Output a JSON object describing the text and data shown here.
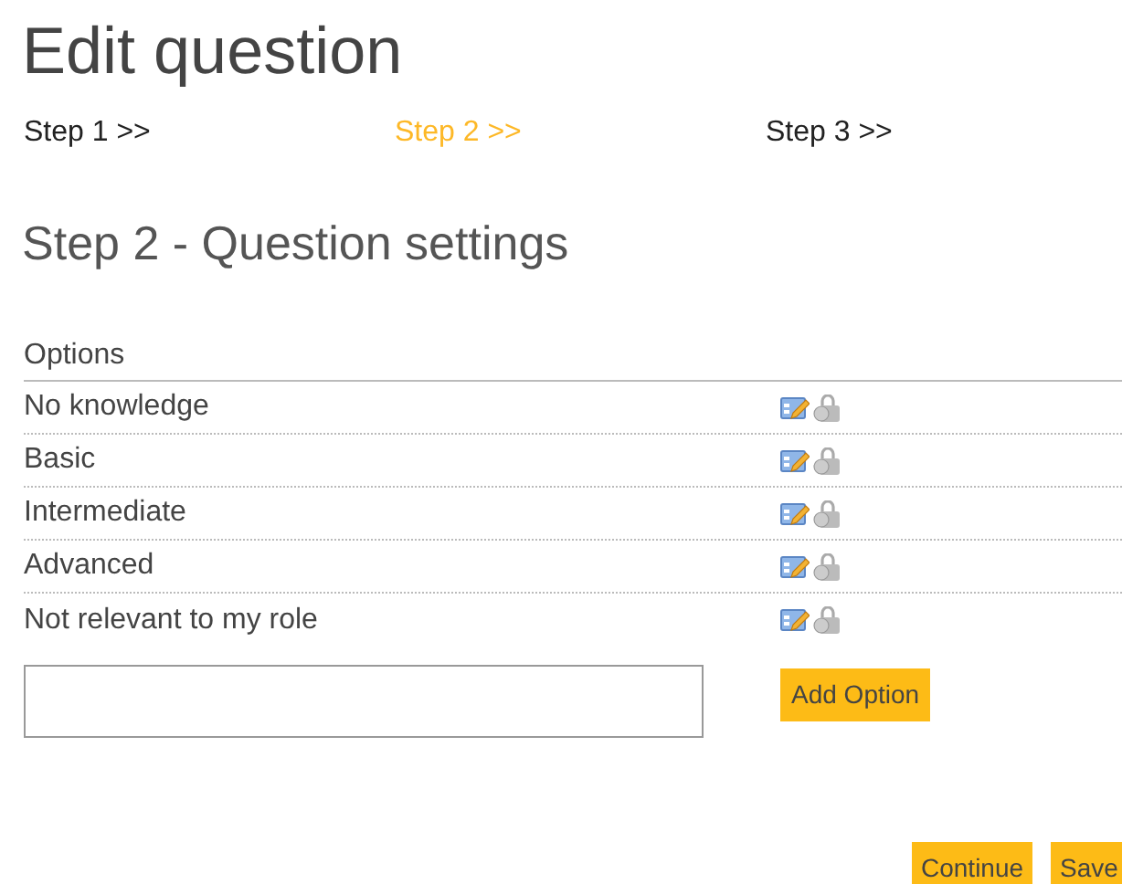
{
  "title": "Edit question",
  "steps": [
    {
      "label": "Step 1 >>",
      "selected": false
    },
    {
      "label": "Step 2 >>",
      "selected": true
    },
    {
      "label": "Step 3 >>",
      "selected": false
    }
  ],
  "section_title": "Step 2 - Question settings",
  "options_header": "Options",
  "options": [
    {
      "label": "No knowledge"
    },
    {
      "label": "Basic"
    },
    {
      "label": "Intermediate"
    },
    {
      "label": "Advanced"
    },
    {
      "label": "Not relevant to my role"
    }
  ],
  "add_button": "Add Option",
  "buttons": [
    "Continue",
    "Save"
  ]
}
